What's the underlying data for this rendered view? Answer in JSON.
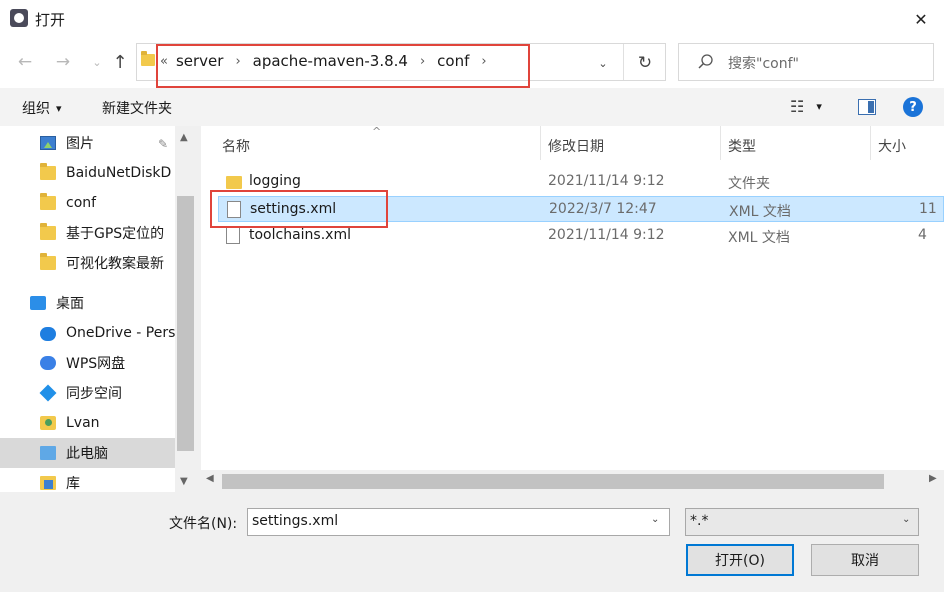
{
  "window": {
    "title": "打开",
    "close_glyph": "✕"
  },
  "nav": {
    "back_glyph": "←",
    "forward_glyph": "→",
    "recent_glyph": "⌄",
    "up_glyph": "↑",
    "refresh_glyph": "↻",
    "dropdown_glyph": "⌄"
  },
  "address": {
    "more_glyph": "«",
    "crumbs": [
      "server",
      "apache-maven-3.8.4",
      "conf"
    ],
    "sep": "›"
  },
  "search": {
    "placeholder": "搜索\"conf\""
  },
  "toolbar": {
    "organize_label": "组织",
    "organize_arrow": "▾",
    "newfolder_label": "新建文件夹",
    "view_glyph": "☷",
    "view_arrow": "▾",
    "help_label": "?"
  },
  "nav_pane": {
    "pin_glyph": "📌",
    "items": [
      {
        "label": "图片",
        "icon": "pictures-icon"
      },
      {
        "label": "BaiduNetDiskD",
        "icon": "folder-icon"
      },
      {
        "label": "conf",
        "icon": "folder-icon"
      },
      {
        "label": "基于GPS定位的",
        "icon": "folder-icon"
      },
      {
        "label": "可视化教案最新",
        "icon": "folder-icon"
      },
      {
        "label": "桌面",
        "icon": "desktop-icon"
      },
      {
        "label": "OneDrive - Pers",
        "icon": "onedrive-icon"
      },
      {
        "label": "WPS网盘",
        "icon": "wps-cloud-icon"
      },
      {
        "label": "同步空间",
        "icon": "sync-space-icon"
      },
      {
        "label": "Lvan",
        "icon": "user-folder-icon"
      },
      {
        "label": "此电脑",
        "icon": "this-pc-icon"
      },
      {
        "label": "库",
        "icon": "library-icon"
      }
    ],
    "selected": "此电脑",
    "scroll_up": "▲",
    "scroll_down": "▼"
  },
  "file_list": {
    "columns": {
      "name": "名称",
      "date": "修改日期",
      "type": "类型",
      "size": "大小"
    },
    "sort_glyph": "^",
    "rows": [
      {
        "name": "logging",
        "date": "2021/11/14 9:12",
        "type": "文件夹",
        "size": "",
        "icon": "folder-icon"
      },
      {
        "name": "settings.xml",
        "date": "2022/3/7 12:47",
        "type": "XML 文档",
        "size": "11",
        "icon": "xml-file-icon",
        "selected": true
      },
      {
        "name": "toolchains.xml",
        "date": "2021/11/14 9:12",
        "type": "XML 文档",
        "size": "4",
        "icon": "xml-file-icon"
      }
    ],
    "hscroll_left": "◀",
    "hscroll_right": "▶"
  },
  "bottom": {
    "filename_label": "文件名(N):",
    "filename_value": "settings.xml",
    "filter_value": "*.*",
    "dropdown_glyph": "⌄",
    "open_label": "打开(O)",
    "cancel_label": "取消"
  },
  "colors": {
    "highlight_box": "#e0443b",
    "selected_row": "#cce8ff",
    "accent": "#0078d4"
  }
}
